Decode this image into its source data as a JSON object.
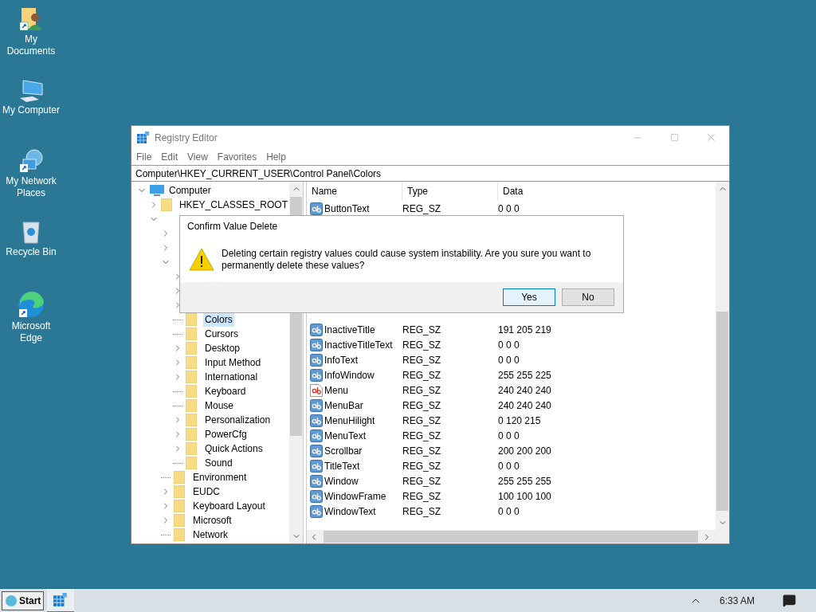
{
  "desktop_icons": [
    {
      "label": "My Documents",
      "kind": "documents"
    },
    {
      "label": "My Computer",
      "kind": "computer"
    },
    {
      "label": "My Network Places",
      "kind": "network"
    },
    {
      "label": "Recycle Bin",
      "kind": "recycle"
    },
    {
      "label": "Microsoft Edge",
      "kind": "edge"
    }
  ],
  "window": {
    "title": "Registry Editor",
    "menu": [
      "File",
      "Edit",
      "View",
      "Favorites",
      "Help"
    ],
    "address": "Computer\\HKEY_CURRENT_USER\\Control Panel\\Colors",
    "tree": [
      {
        "label": "Computer",
        "kind": "computer",
        "expanded": true,
        "children": [
          {
            "label": "HKEY_CLASSES_ROOT",
            "expanded": false
          },
          {
            "expanded": true,
            "children": [
              {
                "expanded": false
              },
              {
                "expanded": false
              },
              {
                "expanded": true,
                "children": [
                  {
                    "expanded": false
                  },
                  {
                    "expanded": false
                  },
                  {
                    "expanded": false
                  },
                  {
                    "label": "Colors",
                    "selected": true
                  },
                  {
                    "label": "Cursors",
                    "selected": false
                  },
                  {
                    "label": "Desktop",
                    "expanded": false
                  },
                  {
                    "label": "Input Method",
                    "expanded": false
                  },
                  {
                    "label": "International",
                    "expanded": false
                  },
                  {
                    "label": "Keyboard",
                    "selected": false
                  },
                  {
                    "label": "Mouse",
                    "selected": false
                  },
                  {
                    "label": "Personalization",
                    "expanded": false
                  },
                  {
                    "label": "PowerCfg",
                    "expanded": false
                  },
                  {
                    "label": "Quick Actions",
                    "expanded": false
                  },
                  {
                    "label": "Sound",
                    "selected": false
                  }
                ]
              },
              {
                "label": "Environment",
                "selected": false
              },
              {
                "label": "EUDC",
                "expanded": false
              },
              {
                "label": "Keyboard Layout",
                "expanded": false
              },
              {
                "label": "Microsoft",
                "expanded": false
              },
              {
                "label": "Network",
                "selected": false
              }
            ]
          }
        ]
      }
    ],
    "columns": [
      "Name",
      "Type",
      "Data"
    ],
    "values_top": [
      {
        "name": "ButtonText",
        "type": "REG_SZ",
        "data": "0 0 0",
        "kind": "string"
      }
    ],
    "values": [
      {
        "name": "InactiveTitle",
        "type": "REG_SZ",
        "data": "191 205 219",
        "kind": "string"
      },
      {
        "name": "InactiveTitleText",
        "type": "REG_SZ",
        "data": "0 0 0",
        "kind": "string"
      },
      {
        "name": "InfoText",
        "type": "REG_SZ",
        "data": "0 0 0",
        "kind": "string"
      },
      {
        "name": "InfoWindow",
        "type": "REG_SZ",
        "data": "255 255 225",
        "kind": "string"
      },
      {
        "name": "Menu",
        "type": "REG_SZ",
        "data": "240 240 240",
        "kind": "document"
      },
      {
        "name": "MenuBar",
        "type": "REG_SZ",
        "data": "240 240 240",
        "kind": "string"
      },
      {
        "name": "MenuHilight",
        "type": "REG_SZ",
        "data": "0 120 215",
        "kind": "string"
      },
      {
        "name": "MenuText",
        "type": "REG_SZ",
        "data": "0 0 0",
        "kind": "string"
      },
      {
        "name": "Scrollbar",
        "type": "REG_SZ",
        "data": "200 200 200",
        "kind": "string"
      },
      {
        "name": "TitleText",
        "type": "REG_SZ",
        "data": "0 0 0",
        "kind": "string"
      },
      {
        "name": "Window",
        "type": "REG_SZ",
        "data": "255 255 255",
        "kind": "string"
      },
      {
        "name": "WindowFrame",
        "type": "REG_SZ",
        "data": "100 100 100",
        "kind": "string"
      },
      {
        "name": "WindowText",
        "type": "REG_SZ",
        "data": "0 0 0",
        "kind": "string"
      }
    ]
  },
  "dialog": {
    "title": "Confirm Value Delete",
    "message": "Deleting certain registry values could cause system instability. Are you sure you want to permanently delete these values?",
    "buttons": [
      {
        "label": "Yes",
        "selected": true
      },
      {
        "label": "No",
        "selected": false
      }
    ]
  },
  "taskbar": {
    "start": "Start",
    "time": "6:33 AM"
  }
}
